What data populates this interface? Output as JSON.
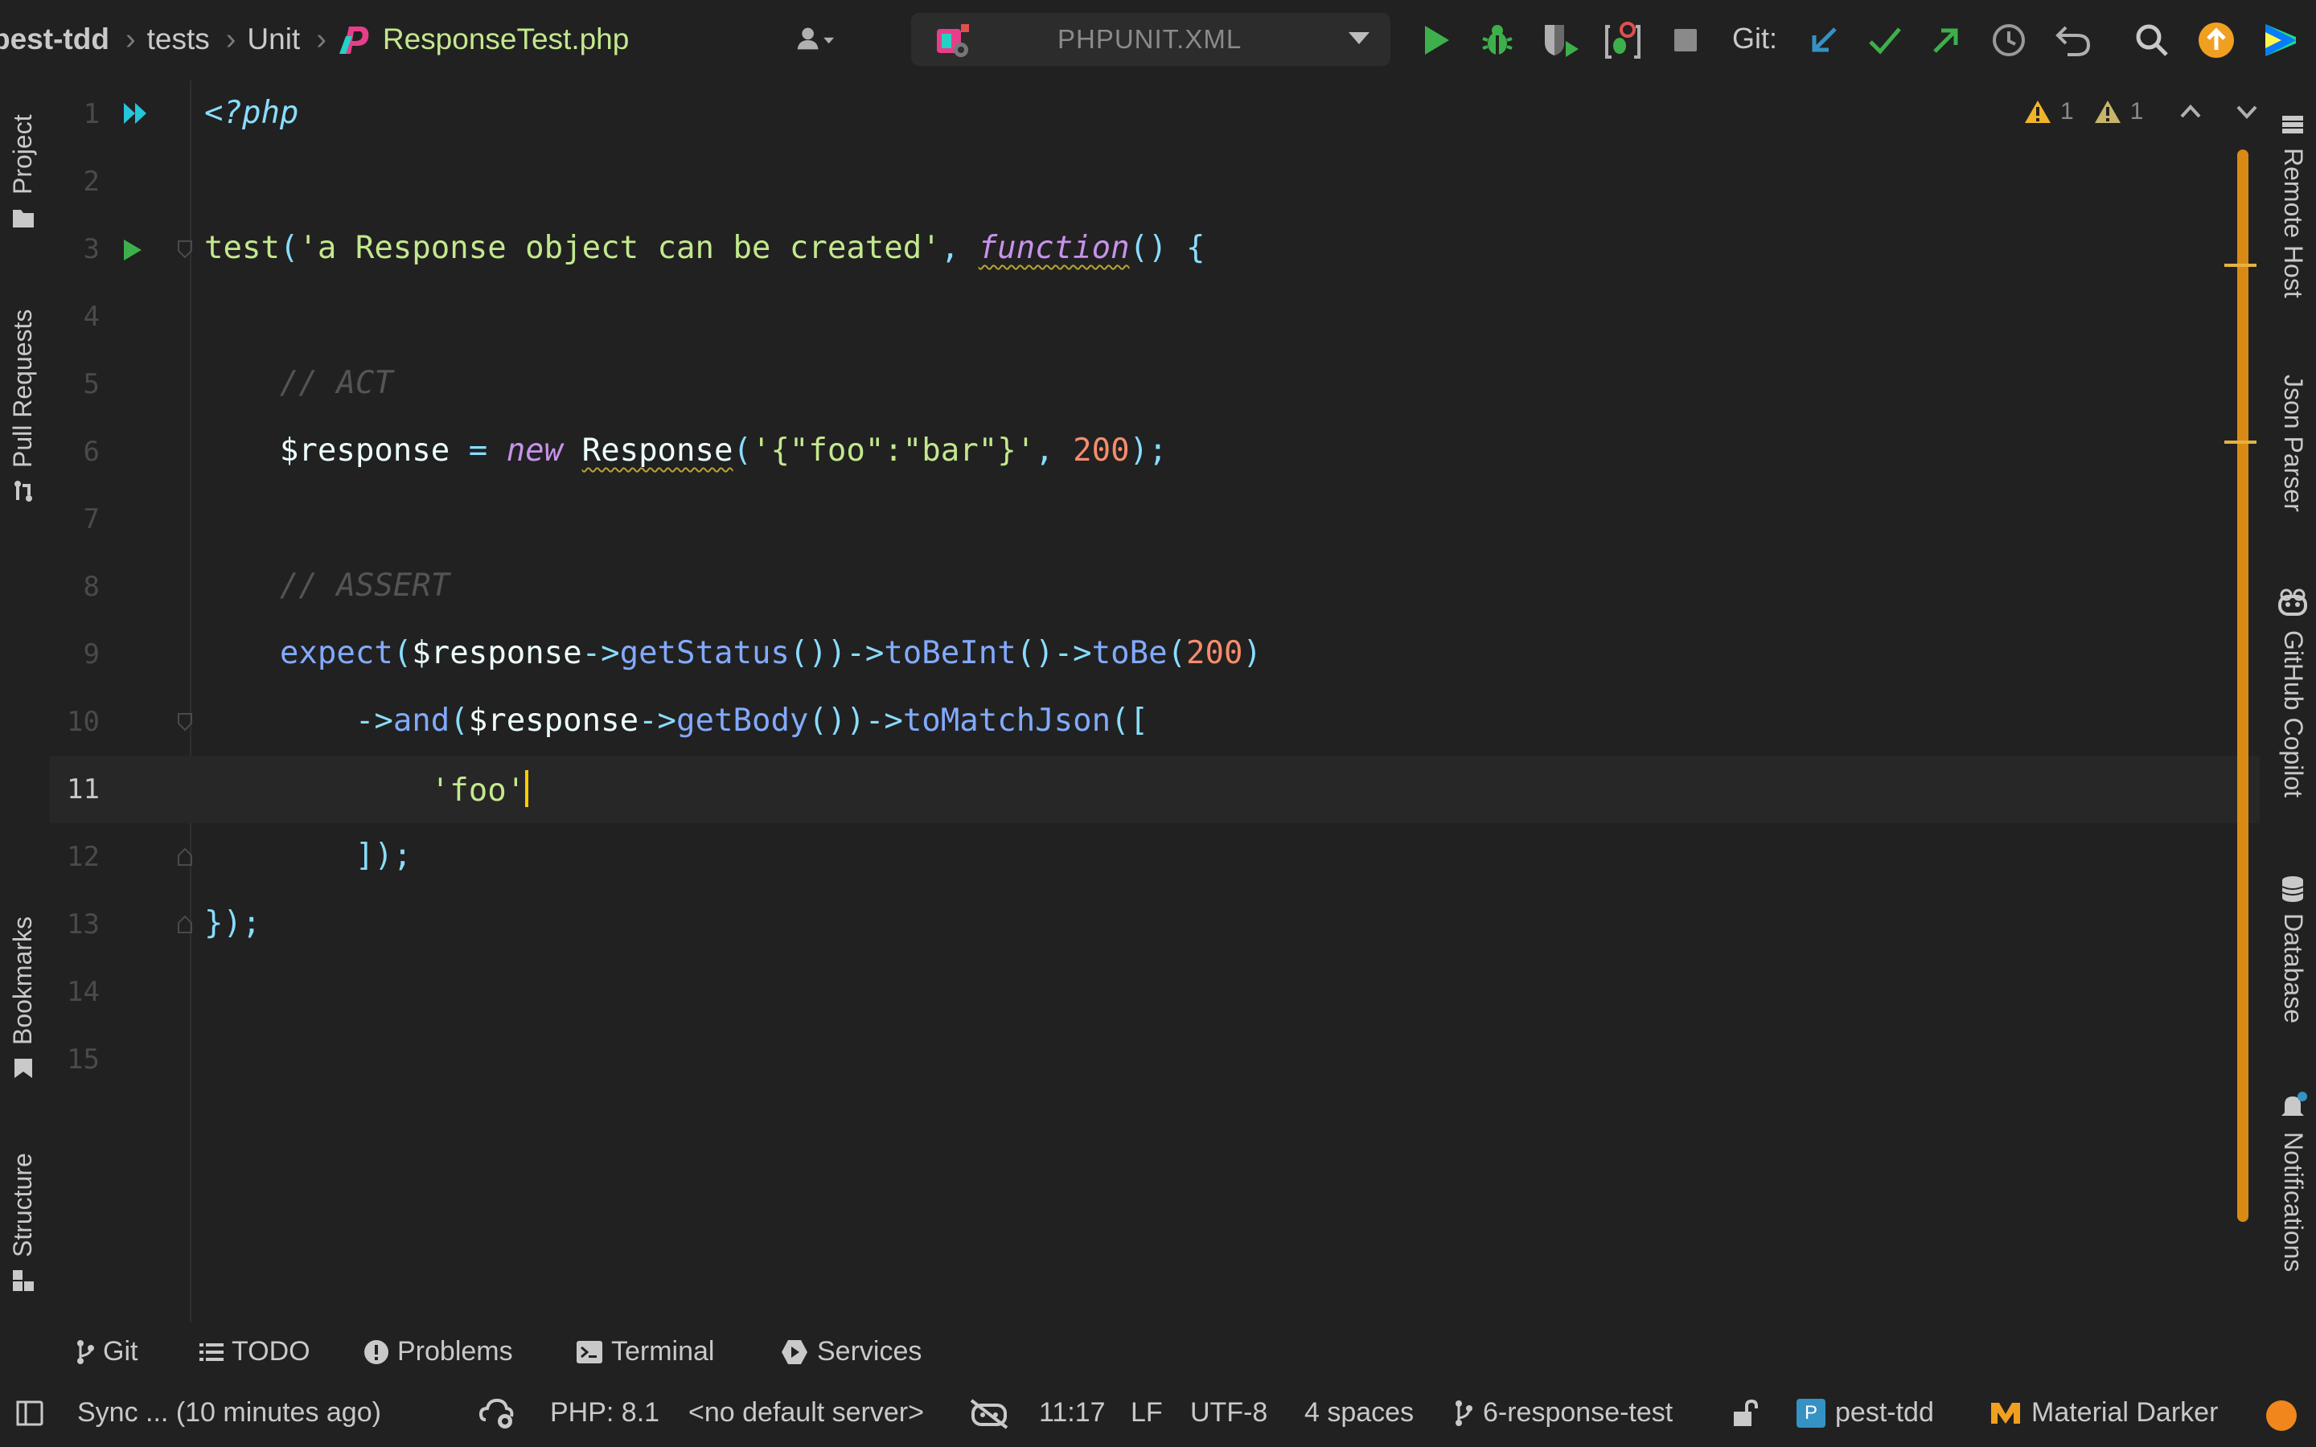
{
  "toolbar": {
    "breadcrumbs": [
      "pest-tdd",
      "tests",
      "Unit",
      "ResponseTest.php"
    ],
    "run_config": "PHPUNIT.XML",
    "git_label": "Git:",
    "icons": [
      "account-icon",
      "run-icon",
      "debug-icon",
      "coverage-icon",
      "profile-icon",
      "stop-icon",
      "git-update-icon",
      "git-commit-icon",
      "git-push-icon",
      "history-icon",
      "rollback-icon",
      "search-icon",
      "ide-update-icon",
      "jetbrains-toolbox-icon"
    ]
  },
  "editor": {
    "lines": [
      {
        "n": "1"
      },
      {
        "n": "2"
      },
      {
        "n": "3"
      },
      {
        "n": "4"
      },
      {
        "n": "5"
      },
      {
        "n": "6"
      },
      {
        "n": "7"
      },
      {
        "n": "8"
      },
      {
        "n": "9"
      },
      {
        "n": "10"
      },
      {
        "n": "11"
      },
      {
        "n": "12"
      },
      {
        "n": "13"
      },
      {
        "n": "14"
      },
      {
        "n": "15"
      }
    ],
    "tokens": {
      "php_open": "<?php",
      "test_fn": "test",
      "test_name": "'a Response object can be created'",
      "function_kw": "function",
      "comment_act": "// ACT",
      "response_var": "$response",
      "new_kw": "new",
      "response_class": "Response",
      "json_str": "'{\"foo\":\"bar\"}'",
      "status_200": "200",
      "comment_assert": "// ASSERT",
      "expect_fn": "expect",
      "get_status": "getStatus",
      "to_be_int": "toBeInt",
      "to_be": "toBe",
      "and_fn": "and",
      "get_body": "getBody",
      "to_match_json": "toMatchJson",
      "foo_str": "'foo'"
    },
    "current_line": "11",
    "inspections": {
      "warnings": "1",
      "weak_warnings": "1"
    },
    "accent_color": "#d98a14"
  },
  "left_tools": [
    "Project",
    "Pull Requests",
    "Bookmarks",
    "Structure"
  ],
  "right_tools": [
    "Remote Host",
    "Json Parser",
    "GitHub Copilot",
    "Database",
    "Notifications"
  ],
  "bottom_tools": [
    "Git",
    "TODO",
    "Problems",
    "Terminal",
    "Services"
  ],
  "status": {
    "sync": "Sync ... (10 minutes ago)",
    "php": "PHP: 8.1",
    "server": "<no default server>",
    "position": "11:17",
    "line_sep": "LF",
    "encoding": "UTF-8",
    "indent": "4 spaces",
    "branch": "6-response-test",
    "project": "pest-tdd",
    "project_badge": "P",
    "theme": "Material Darker"
  }
}
